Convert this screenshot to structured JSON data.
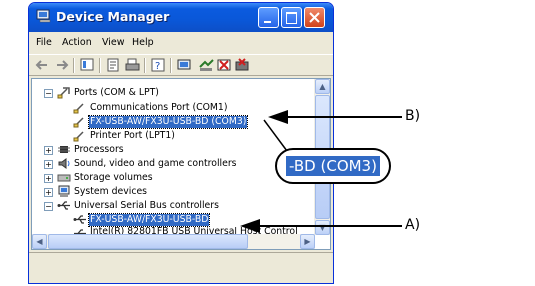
{
  "window": {
    "title": "Device Manager",
    "icon": "device-manager-icon"
  },
  "menu": {
    "file": "File",
    "action": "Action",
    "view": "View",
    "help": "Help"
  },
  "toolbar": {
    "buttons": [
      "back-icon",
      "forward-icon",
      "up-icon",
      "properties-icon",
      "print-icon",
      "help-icon",
      "scan-icon",
      "update-driver-icon",
      "disable-icon",
      "uninstall-icon"
    ]
  },
  "tree": {
    "ports_group": "Ports (COM & LPT)",
    "com1": "Communications Port (COM1)",
    "com3_device": "FX-USB-AW/FX3U-USB-BD (COM3)",
    "lpt1": "Printer Port (LPT1)",
    "processors": "Processors",
    "sound": "Sound, video and game controllers",
    "storage": "Storage volumes",
    "system": "System devices",
    "usb_group": "Universal Serial Bus controllers",
    "usb_device": "FX-USB-AW/FX3U-USB-BD",
    "intel_partial": "Intel(R) 82801FB USB Universal Host Control"
  },
  "callout": {
    "zoom_text": "-BD (COM3)"
  },
  "annotations": {
    "b": "B)",
    "a": "A)"
  },
  "colors": {
    "selection": "#316ac5",
    "titlebar": "#0a57d8"
  }
}
